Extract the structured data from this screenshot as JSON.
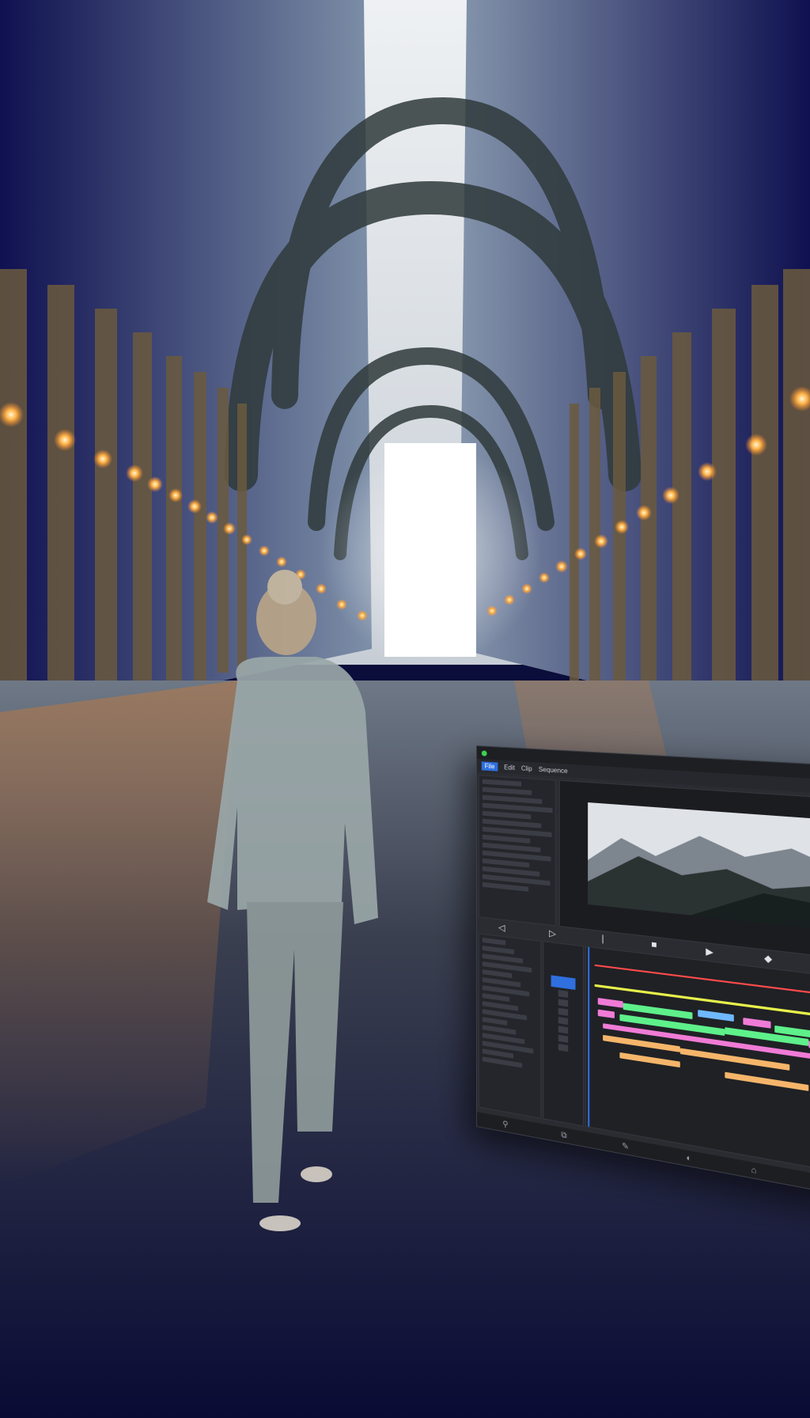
{
  "scene": {
    "description_icons": [
      "figure-walking",
      "arch-corridor",
      "string-lights"
    ]
  },
  "editor": {
    "menu_tabs": [
      "File",
      "Edit",
      "Clip",
      "Sequence"
    ],
    "window_title": "",
    "top_right_label": "",
    "project_panel_items": 14,
    "viewer": {
      "left_label": "",
      "center_label": "",
      "right_label": ""
    },
    "playback_controls": [
      "◁",
      "▷",
      "|",
      "■",
      "▶",
      "◆",
      "▶"
    ],
    "timeline_header": "",
    "colors": {
      "accent": "#2f6fde",
      "track_green": "#5ef08a",
      "track_pink": "#f07bd6",
      "track_orange": "#f5b56a",
      "track_blue": "#6fb8ff",
      "playhead_red": "#ff4b4b"
    }
  }
}
